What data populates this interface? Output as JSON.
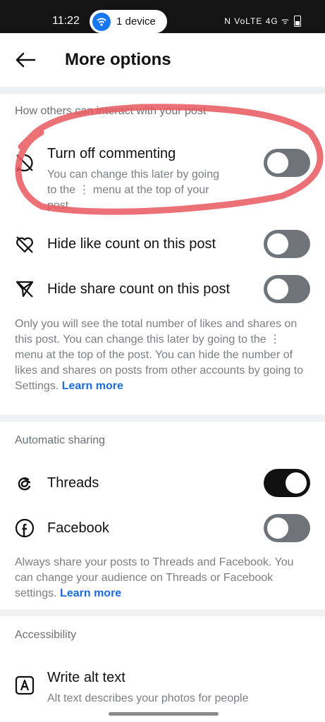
{
  "status_bar": {
    "time": "11:22",
    "device_pill": "1 device",
    "right_indicators": "N  VoLTE  4G  ᯤ"
  },
  "header": {
    "title": "More options"
  },
  "interact": {
    "section_label": "How others can interact with your post",
    "comment": {
      "title": "Turn off commenting",
      "subtitle_a": "You can change this later by going",
      "subtitle_b": "to the ⋮ menu at the top of your",
      "subtitle_c": "post.",
      "on": false
    },
    "like": {
      "title": "Hide like count on this post",
      "on": false
    },
    "share": {
      "title": "Hide share count on this post",
      "on": false
    },
    "note": "Only you will see the total number of likes and shares on this post. You can change this later by going to the ⋮ menu at the top of the post. You can hide the number of likes and shares on posts from other accounts by going to Settings.",
    "note_link": "Learn more"
  },
  "sharing": {
    "section_label": "Automatic sharing",
    "threads": {
      "title": "Threads",
      "on": true
    },
    "facebook": {
      "title": "Facebook",
      "on": false
    },
    "note": "Always share your posts to Threads and Facebook. You can change your audience on Threads or Facebook settings.",
    "note_link": "Learn more"
  },
  "accessibility": {
    "section_label": "Accessibility",
    "alt": {
      "title": "Write alt text",
      "subtitle": "Alt text describes your photos for people"
    }
  },
  "colors": {
    "toggle_off": "#6f737a",
    "toggle_on": "#111111",
    "link": "#1c6bd8",
    "annotation": "#e8585e"
  }
}
